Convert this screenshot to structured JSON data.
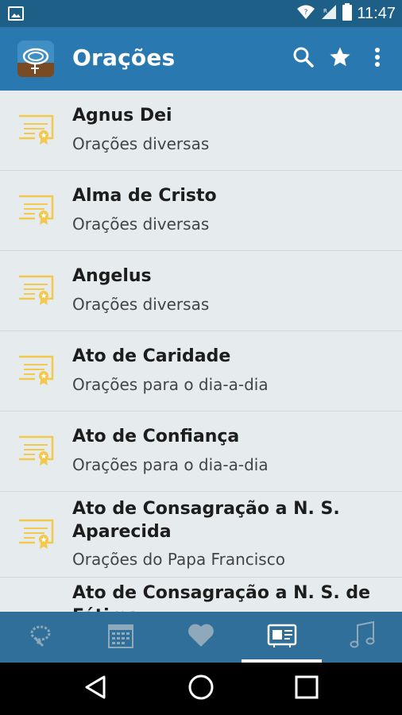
{
  "status_bar": {
    "time": "11:47",
    "icons": [
      "image-icon",
      "wifi-icon",
      "signal-icon",
      "battery-icon"
    ]
  },
  "app_bar": {
    "title": "Orações",
    "actions": [
      "search-icon",
      "star-icon",
      "more-vert-icon"
    ],
    "color": "#2979b0"
  },
  "prayers": [
    {
      "title": "Agnus Dei",
      "category": "Orações diversas"
    },
    {
      "title": "Alma de Cristo",
      "category": "Orações diversas"
    },
    {
      "title": "Angelus",
      "category": "Orações diversas"
    },
    {
      "title": "Ato de Caridade",
      "category": "Orações para o dia-a-dia"
    },
    {
      "title": "Ato de Confiança",
      "category": "Orações para o dia-a-dia"
    },
    {
      "title": "Ato de Consagração a N. S. Aparecida",
      "category": "Orações do Papa Francisco"
    },
    {
      "title": "Ato de Consagração a N. S. de Fátima",
      "category": ""
    }
  ],
  "bottom_nav": {
    "items": [
      "rosary-icon",
      "calendar-icon",
      "heart-icon",
      "prayer-card-icon",
      "music-icon"
    ],
    "selected_index": 3
  },
  "colors": {
    "status_bar": "#1d5f87",
    "bottom_nav": "#2f6f99",
    "list_background": "#e6ecee",
    "certificate_icon": "#f2c94c"
  }
}
